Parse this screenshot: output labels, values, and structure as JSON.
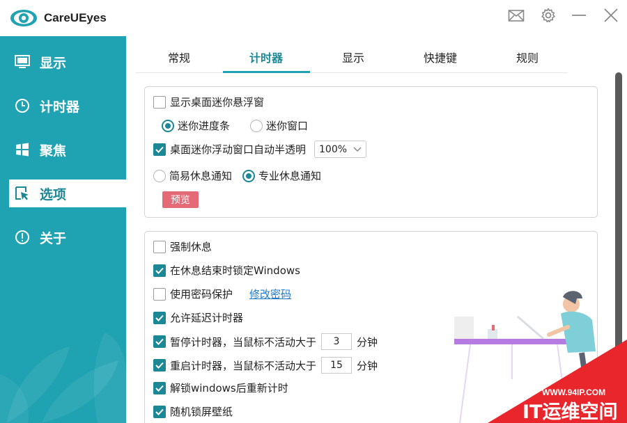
{
  "app": {
    "title": "CareUEyes"
  },
  "sidebar": {
    "items": [
      {
        "label": "显示",
        "icon": "monitor-icon"
      },
      {
        "label": "计时器",
        "icon": "clock-icon"
      },
      {
        "label": "聚焦",
        "icon": "windows-icon"
      },
      {
        "label": "选项",
        "icon": "cursor-icon",
        "active": true
      },
      {
        "label": "关于",
        "icon": "info-icon"
      }
    ]
  },
  "tabs": [
    {
      "label": "常规"
    },
    {
      "label": "计时器",
      "active": true
    },
    {
      "label": "显示"
    },
    {
      "label": "快捷键"
    },
    {
      "label": "规则"
    }
  ],
  "panel1": {
    "show_mini_window": {
      "label": "显示桌面迷你悬浮窗",
      "checked": false
    },
    "mini_progress": {
      "label": "迷你进度条",
      "selected": true
    },
    "mini_window": {
      "label": "迷你窗口",
      "selected": false
    },
    "auto_transparent": {
      "label": "桌面迷你浮动窗口自动半透明",
      "checked": true
    },
    "opacity": "100%",
    "simple_notify": {
      "label": "简易休息通知",
      "selected": false
    },
    "pro_notify": {
      "label": "专业休息通知",
      "selected": true
    },
    "preview_button": "预览"
  },
  "panel2": {
    "force_rest": {
      "label": "强制休息",
      "checked": false
    },
    "lock_windows": {
      "label": "在休息结束时锁定Windows",
      "checked": true
    },
    "password": {
      "label": "使用密码保护",
      "checked": false,
      "link": "修改密码"
    },
    "allow_delay": {
      "label": "允许延迟计时器",
      "checked": true
    },
    "pause_timer": {
      "label": "暂停计时器，当鼠标不活动大于",
      "checked": true,
      "value": "3",
      "unit": "分钟"
    },
    "restart_timer": {
      "label": "重启计时器，当鼠标不活动大于",
      "checked": true,
      "value": "15",
      "unit": "分钟"
    },
    "unlock_reset": {
      "label": "解锁windows后重新计时",
      "checked": true
    },
    "random_wallpaper": {
      "label": "随机锁屏壁纸",
      "checked": true
    }
  },
  "watermark": {
    "url": "WWW.94IP.COM",
    "text": "IT运维空间"
  },
  "colors": {
    "accent": "#1fa2b1",
    "accent_dark": "#1c8795",
    "preview": "#e56a77"
  }
}
